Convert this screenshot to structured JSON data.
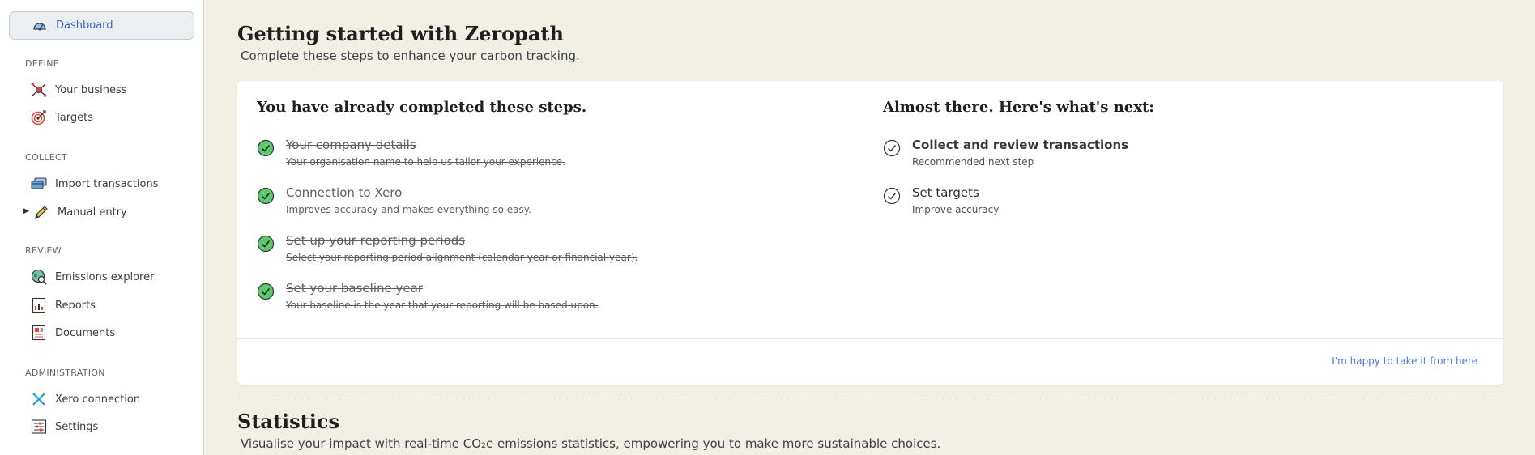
{
  "sidebar": {
    "dashboard_label": "Dashboard",
    "sections": [
      {
        "title": "DEFINE",
        "items": [
          {
            "label": "Your business",
            "icon": "network-node-icon"
          },
          {
            "label": "Targets",
            "icon": "target-icon"
          }
        ]
      },
      {
        "title": "COLLECT",
        "items": [
          {
            "label": "Import transactions",
            "icon": "cards-icon"
          },
          {
            "label": "Manual entry",
            "icon": "pencil-icon"
          }
        ]
      },
      {
        "title": "REVIEW",
        "items": [
          {
            "label": "Emissions explorer",
            "icon": "globe-magnifier-icon"
          },
          {
            "label": "Reports",
            "icon": "chart-report-icon"
          },
          {
            "label": "Documents",
            "icon": "document-icon"
          }
        ]
      },
      {
        "title": "ADMINISTRATION",
        "items": [
          {
            "label": "Xero connection",
            "icon": "x-icon"
          },
          {
            "label": "Settings",
            "icon": "sliders-icon"
          }
        ]
      }
    ]
  },
  "main": {
    "title": "Getting started with Zeropath",
    "subtitle": "Complete these steps to enhance your carbon tracking.",
    "completed": {
      "heading": "You have already completed these steps.",
      "steps": [
        {
          "title": "Your company details",
          "desc": "Your organisation name to help us tailor your experience."
        },
        {
          "title": "Connection to Xero",
          "desc": "Improves accuracy and makes everything so easy."
        },
        {
          "title": "Set up your reporting periods",
          "desc": "Select your reporting period alignment (calendar year or financial year)."
        },
        {
          "title": "Set your baseline year",
          "desc": "Your baseline is the year that your reporting will be based upon."
        }
      ]
    },
    "next": {
      "heading": "Almost there. Here's what's next:",
      "steps": [
        {
          "title": "Collect and review transactions",
          "desc": "Recommended next step"
        },
        {
          "title": "Set targets",
          "desc": "Improve accuracy"
        }
      ]
    },
    "happy_link": "I'm happy to take it from here",
    "stats_title": "Statistics",
    "stats_subtitle": "Visualise your impact with real-time CO₂e emissions statistics, empowering you to make more sustainable choices."
  },
  "colors": {
    "accent": "#3a64c9",
    "check_green": "#5fc96d",
    "background": "#f2f0e5"
  }
}
